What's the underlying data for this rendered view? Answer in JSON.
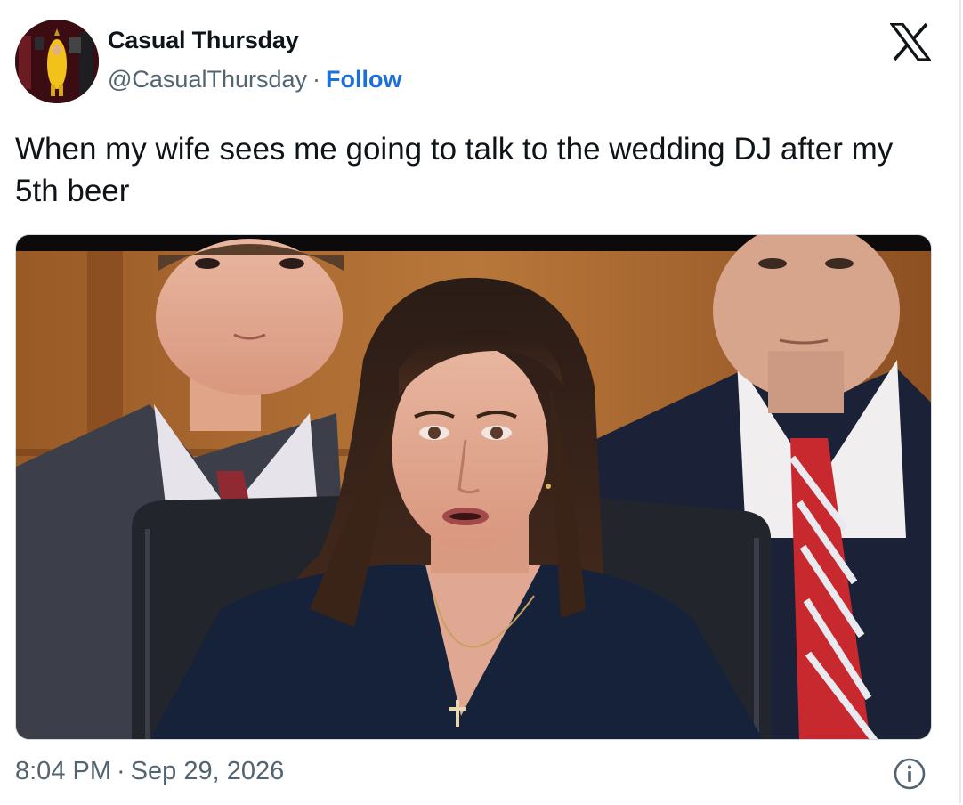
{
  "author": {
    "display_name": "Casual Thursday",
    "handle": "@CasualThursday",
    "separator": "·",
    "follow_label": "Follow",
    "avatar_icon": "banana-costume-avatar"
  },
  "close_icon": "x-logo-icon",
  "tweet": {
    "text": "When my wife sees me going to talk to the wedding DJ after my 5th beer"
  },
  "media": {
    "icon": "photo-three-people-hearing"
  },
  "footer": {
    "time": "8:04 PM",
    "separator": "·",
    "date": "Sep 29, 2026",
    "info_icon": "info-icon"
  },
  "colors": {
    "text": "#0f1419",
    "secondary": "#536471",
    "link": "#1d6fd9"
  }
}
